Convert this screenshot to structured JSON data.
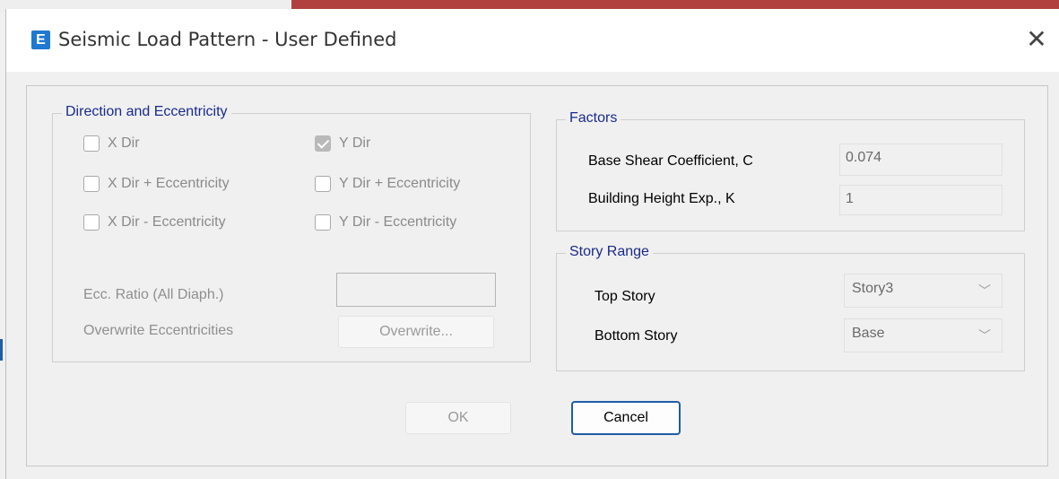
{
  "window": {
    "title": "Seismic Load Pattern - User Defined",
    "icon_letter": "E",
    "close_glyph": "✕"
  },
  "direction": {
    "group_title": "Direction and Eccentricity",
    "x_dir": {
      "label": "X Dir",
      "checked": false
    },
    "y_dir": {
      "label": "Y Dir",
      "checked": true
    },
    "x_dir_plus_ecc": {
      "label": "X Dir + Eccentricity",
      "checked": false
    },
    "y_dir_plus_ecc": {
      "label": "Y Dir + Eccentricity",
      "checked": false
    },
    "x_dir_minus_ecc": {
      "label": "X Dir - Eccentricity",
      "checked": false
    },
    "y_dir_minus_ecc": {
      "label": "Y Dir - Eccentricity",
      "checked": false
    },
    "ecc_ratio_label": "Ecc. Ratio (All Diaph.)",
    "ecc_ratio_value": "",
    "overwrite_label": "Overwrite Eccentricities",
    "overwrite_button": "Overwrite..."
  },
  "factors": {
    "group_title": "Factors",
    "base_shear_label": "Base Shear Coefficient, C",
    "base_shear_value": "0.074",
    "height_exp_label": "Building Height Exp., K",
    "height_exp_value": "1"
  },
  "story_range": {
    "group_title": "Story Range",
    "top_story_label": "Top Story",
    "top_story_value": "Story3",
    "bottom_story_label": "Bottom Story",
    "bottom_story_value": "Base"
  },
  "buttons": {
    "ok": "OK",
    "cancel": "Cancel"
  },
  "icons": {
    "chevron": "﹀"
  },
  "colors": {
    "accent": "#1f5da6",
    "group_title": "#1a2a8c",
    "app_icon": "#1f78d1"
  }
}
